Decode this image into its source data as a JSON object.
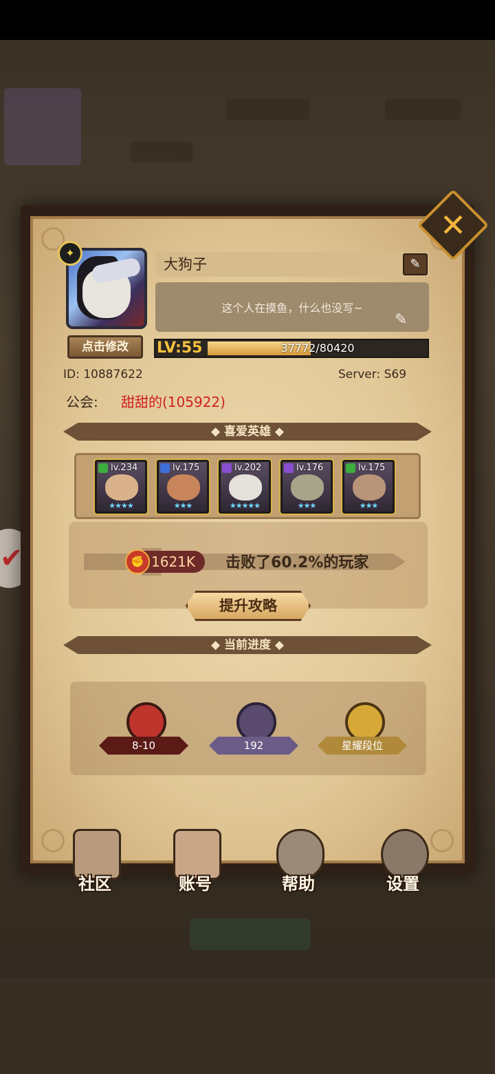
{
  "profile": {
    "name": "大狗子",
    "signature": "这个人在摸鱼，什么也没写~",
    "modify_label": "点击修改",
    "level_label": "LV:55",
    "exp_current": 37772,
    "exp_max": 80420,
    "exp_text": "37772/80420",
    "id_text": "ID:  10887622",
    "server_text": "Server:  S69",
    "guild_label": "公会:",
    "guild_name": "甜甜的(105922)"
  },
  "sections": {
    "favorite_heroes": "喜爱英雄",
    "current_progress": "当前进度"
  },
  "heroes": [
    {
      "level": "lv.234",
      "element_color": "#3cae3c",
      "stars": "★★★★"
    },
    {
      "level": "lv.175",
      "element_color": "#3f6fd8",
      "stars": "★★★"
    },
    {
      "level": "lv.202",
      "element_color": "#8a4fd0",
      "stars": "★★★★★"
    },
    {
      "level": "lv.176",
      "element_color": "#8a4fd0",
      "stars": "★★★"
    },
    {
      "level": "lv.175",
      "element_color": "#3cae3c",
      "stars": "★★★"
    }
  ],
  "power": {
    "value": "1621K",
    "beat_text": "击败了60.2%的玩家",
    "strategy_button": "提升攻略"
  },
  "progress": [
    {
      "label": "8-10",
      "icon": "campaign-book-icon"
    },
    {
      "label": "192",
      "icon": "tower-icon"
    },
    {
      "label": "星耀段位",
      "icon": "arena-rank-icon"
    }
  ],
  "nav": [
    {
      "label": "社区",
      "icon": "castle-icon"
    },
    {
      "label": "账号",
      "icon": "account-card-icon"
    },
    {
      "label": "帮助",
      "icon": "speech-bubble-icon"
    },
    {
      "label": "设置",
      "icon": "gear-icon"
    }
  ],
  "close_icon": "close-icon",
  "colors": {
    "guild_name": "#d02020",
    "level": "#f3c13e",
    "frame": "#a47b48"
  }
}
